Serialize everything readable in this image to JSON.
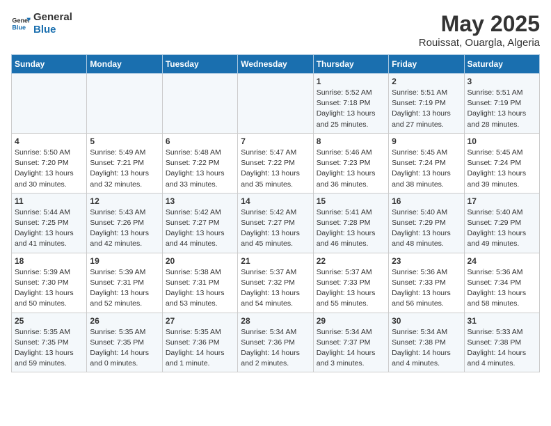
{
  "logo": {
    "text_general": "General",
    "text_blue": "Blue"
  },
  "header": {
    "month": "May 2025",
    "location": "Rouissat, Ouargla, Algeria"
  },
  "weekdays": [
    "Sunday",
    "Monday",
    "Tuesday",
    "Wednesday",
    "Thursday",
    "Friday",
    "Saturday"
  ],
  "weeks": [
    [
      {
        "day": "",
        "detail": ""
      },
      {
        "day": "",
        "detail": ""
      },
      {
        "day": "",
        "detail": ""
      },
      {
        "day": "",
        "detail": ""
      },
      {
        "day": "1",
        "detail": "Sunrise: 5:52 AM\nSunset: 7:18 PM\nDaylight: 13 hours\nand 25 minutes."
      },
      {
        "day": "2",
        "detail": "Sunrise: 5:51 AM\nSunset: 7:19 PM\nDaylight: 13 hours\nand 27 minutes."
      },
      {
        "day": "3",
        "detail": "Sunrise: 5:51 AM\nSunset: 7:19 PM\nDaylight: 13 hours\nand 28 minutes."
      }
    ],
    [
      {
        "day": "4",
        "detail": "Sunrise: 5:50 AM\nSunset: 7:20 PM\nDaylight: 13 hours\nand 30 minutes."
      },
      {
        "day": "5",
        "detail": "Sunrise: 5:49 AM\nSunset: 7:21 PM\nDaylight: 13 hours\nand 32 minutes."
      },
      {
        "day": "6",
        "detail": "Sunrise: 5:48 AM\nSunset: 7:22 PM\nDaylight: 13 hours\nand 33 minutes."
      },
      {
        "day": "7",
        "detail": "Sunrise: 5:47 AM\nSunset: 7:22 PM\nDaylight: 13 hours\nand 35 minutes."
      },
      {
        "day": "8",
        "detail": "Sunrise: 5:46 AM\nSunset: 7:23 PM\nDaylight: 13 hours\nand 36 minutes."
      },
      {
        "day": "9",
        "detail": "Sunrise: 5:45 AM\nSunset: 7:24 PM\nDaylight: 13 hours\nand 38 minutes."
      },
      {
        "day": "10",
        "detail": "Sunrise: 5:45 AM\nSunset: 7:24 PM\nDaylight: 13 hours\nand 39 minutes."
      }
    ],
    [
      {
        "day": "11",
        "detail": "Sunrise: 5:44 AM\nSunset: 7:25 PM\nDaylight: 13 hours\nand 41 minutes."
      },
      {
        "day": "12",
        "detail": "Sunrise: 5:43 AM\nSunset: 7:26 PM\nDaylight: 13 hours\nand 42 minutes."
      },
      {
        "day": "13",
        "detail": "Sunrise: 5:42 AM\nSunset: 7:27 PM\nDaylight: 13 hours\nand 44 minutes."
      },
      {
        "day": "14",
        "detail": "Sunrise: 5:42 AM\nSunset: 7:27 PM\nDaylight: 13 hours\nand 45 minutes."
      },
      {
        "day": "15",
        "detail": "Sunrise: 5:41 AM\nSunset: 7:28 PM\nDaylight: 13 hours\nand 46 minutes."
      },
      {
        "day": "16",
        "detail": "Sunrise: 5:40 AM\nSunset: 7:29 PM\nDaylight: 13 hours\nand 48 minutes."
      },
      {
        "day": "17",
        "detail": "Sunrise: 5:40 AM\nSunset: 7:29 PM\nDaylight: 13 hours\nand 49 minutes."
      }
    ],
    [
      {
        "day": "18",
        "detail": "Sunrise: 5:39 AM\nSunset: 7:30 PM\nDaylight: 13 hours\nand 50 minutes."
      },
      {
        "day": "19",
        "detail": "Sunrise: 5:39 AM\nSunset: 7:31 PM\nDaylight: 13 hours\nand 52 minutes."
      },
      {
        "day": "20",
        "detail": "Sunrise: 5:38 AM\nSunset: 7:31 PM\nDaylight: 13 hours\nand 53 minutes."
      },
      {
        "day": "21",
        "detail": "Sunrise: 5:37 AM\nSunset: 7:32 PM\nDaylight: 13 hours\nand 54 minutes."
      },
      {
        "day": "22",
        "detail": "Sunrise: 5:37 AM\nSunset: 7:33 PM\nDaylight: 13 hours\nand 55 minutes."
      },
      {
        "day": "23",
        "detail": "Sunrise: 5:36 AM\nSunset: 7:33 PM\nDaylight: 13 hours\nand 56 minutes."
      },
      {
        "day": "24",
        "detail": "Sunrise: 5:36 AM\nSunset: 7:34 PM\nDaylight: 13 hours\nand 58 minutes."
      }
    ],
    [
      {
        "day": "25",
        "detail": "Sunrise: 5:35 AM\nSunset: 7:35 PM\nDaylight: 13 hours\nand 59 minutes."
      },
      {
        "day": "26",
        "detail": "Sunrise: 5:35 AM\nSunset: 7:35 PM\nDaylight: 14 hours\nand 0 minutes."
      },
      {
        "day": "27",
        "detail": "Sunrise: 5:35 AM\nSunset: 7:36 PM\nDaylight: 14 hours\nand 1 minute."
      },
      {
        "day": "28",
        "detail": "Sunrise: 5:34 AM\nSunset: 7:36 PM\nDaylight: 14 hours\nand 2 minutes."
      },
      {
        "day": "29",
        "detail": "Sunrise: 5:34 AM\nSunset: 7:37 PM\nDaylight: 14 hours\nand 3 minutes."
      },
      {
        "day": "30",
        "detail": "Sunrise: 5:34 AM\nSunset: 7:38 PM\nDaylight: 14 hours\nand 4 minutes."
      },
      {
        "day": "31",
        "detail": "Sunrise: 5:33 AM\nSunset: 7:38 PM\nDaylight: 14 hours\nand 4 minutes."
      }
    ]
  ]
}
